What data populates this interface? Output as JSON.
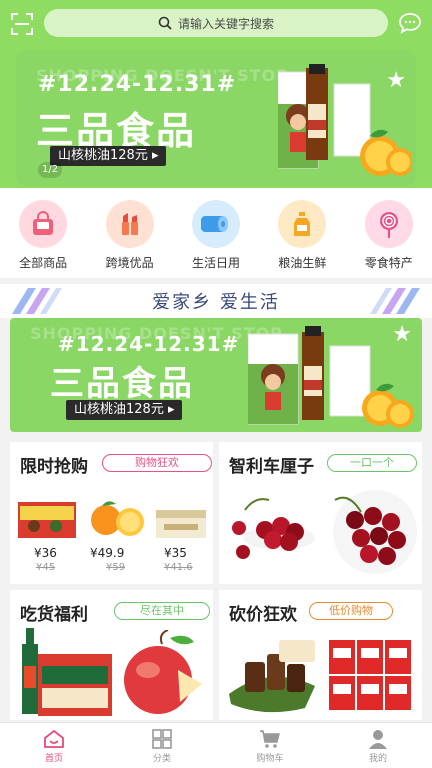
{
  "header": {
    "search_placeholder": "请输入关键字搜索"
  },
  "banner": {
    "ghost_text": "SHOPPING DOESN'T STOP",
    "date": "#12.24-12.31#",
    "title": "三品食品",
    "tag": "山核桃油128元 ▸",
    "pager": "1/2"
  },
  "categories": [
    {
      "label": "全部商品",
      "icon": "shopping-bag-icon",
      "color": "#f0607a"
    },
    {
      "label": "跨境优品",
      "icon": "lipstick-icon",
      "color": "#f57a52"
    },
    {
      "label": "生活日用",
      "icon": "tissue-roll-icon",
      "color": "#3e9be8"
    },
    {
      "label": "粮油生鲜",
      "icon": "oil-bottle-icon",
      "color": "#f5a623"
    },
    {
      "label": "零食特产",
      "icon": "lollipop-icon",
      "color": "#e9508a"
    }
  ],
  "slogan": "爱家乡 爱生活",
  "banner2": {
    "date": "#12.24-12.31#",
    "title": "三品食品",
    "tag": "山核桃油128元 ▸"
  },
  "sections": {
    "flash": {
      "title": "限时抢购",
      "badge": "购物狂欢",
      "badge_color": "#e9508a",
      "items": [
        {
          "price": "¥36",
          "old": "¥45"
        },
        {
          "price": "¥49.9",
          "old": "¥59"
        },
        {
          "price": "¥35",
          "old": "¥41.6"
        }
      ]
    },
    "cherry": {
      "title": "智利车厘子",
      "badge": "一口一个",
      "badge_color": "#6cc36a"
    },
    "foodie": {
      "title": "吃货福利",
      "badge": "尽在其中",
      "badge_color": "#6cc36a"
    },
    "bargain": {
      "title": "砍价狂欢",
      "badge": "低价购物",
      "badge_color": "#e88a2c"
    }
  },
  "nav": [
    {
      "label": "首页",
      "icon": "home-icon",
      "active": true
    },
    {
      "label": "分类",
      "icon": "grid-icon",
      "active": false
    },
    {
      "label": "购物车",
      "icon": "cart-icon",
      "active": false
    },
    {
      "label": "我的",
      "icon": "user-icon",
      "active": false
    }
  ]
}
